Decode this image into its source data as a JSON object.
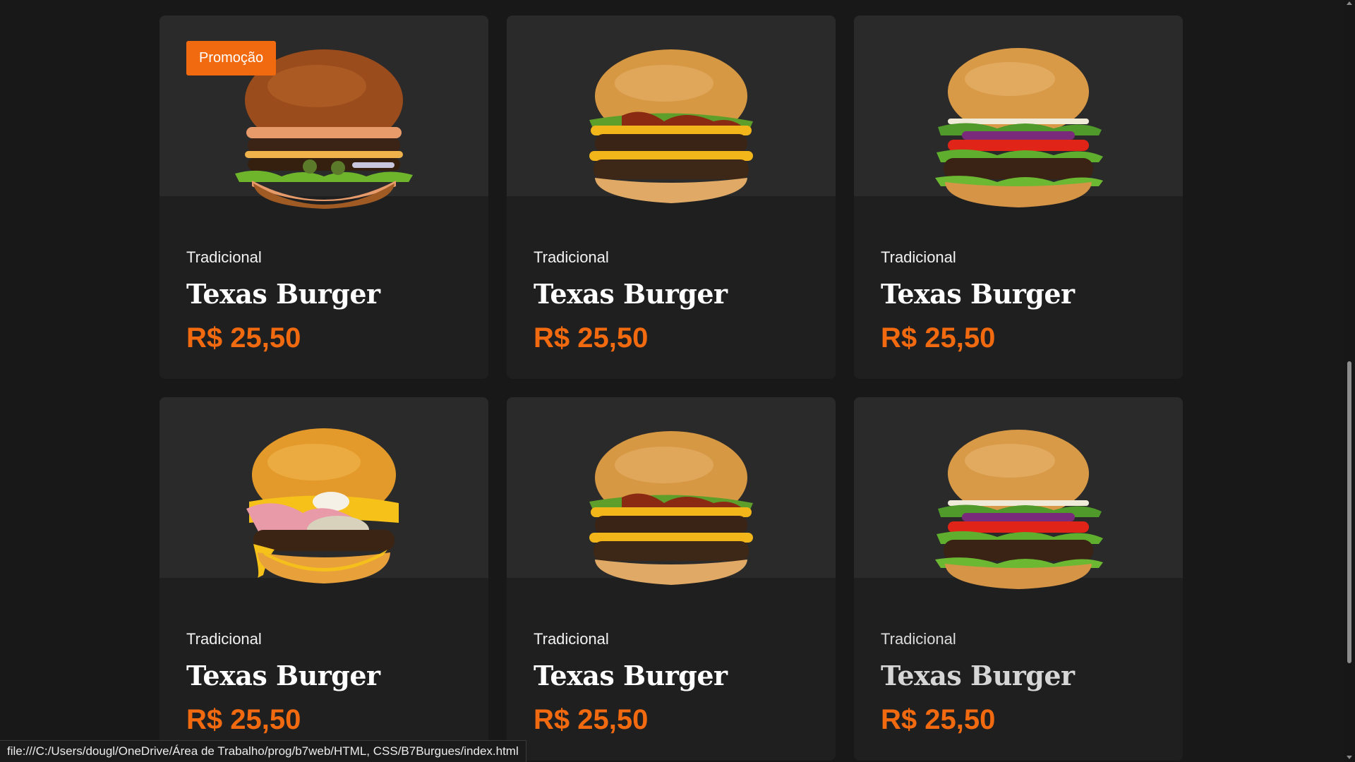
{
  "cards": [
    {
      "badge": "Promoção",
      "category": "Tradicional",
      "title": "Texas Burger",
      "price": "R$ 25,50",
      "image": "burger-sauce-icon"
    },
    {
      "category": "Tradicional",
      "title": "Texas Burger",
      "price": "R$ 25,50",
      "image": "burger-bacon-icon"
    },
    {
      "category": "Tradicional",
      "title": "Texas Burger",
      "price": "R$ 25,50",
      "image": "burger-classic-icon"
    },
    {
      "category": "Tradicional",
      "title": "Texas Burger",
      "price": "R$ 25,50",
      "image": "burger-egg-icon"
    },
    {
      "category": "Tradicional",
      "title": "Texas Burger",
      "price": "R$ 25,50",
      "image": "burger-bacon-icon"
    },
    {
      "category": "Tradicional",
      "title": "Texas Burger",
      "price": "R$ 25,50",
      "image": "burger-classic-icon"
    }
  ],
  "status_bar": {
    "url": "file:///C:/Users/dougl/OneDrive/Área de Trabalho/prog/b7web/HTML, CSS/B7Burgues/index.html"
  },
  "colors": {
    "accent": "#f26a10",
    "background": "#181818",
    "card": "#1f1f1f",
    "card_image_bg": "#2a2a2a"
  }
}
